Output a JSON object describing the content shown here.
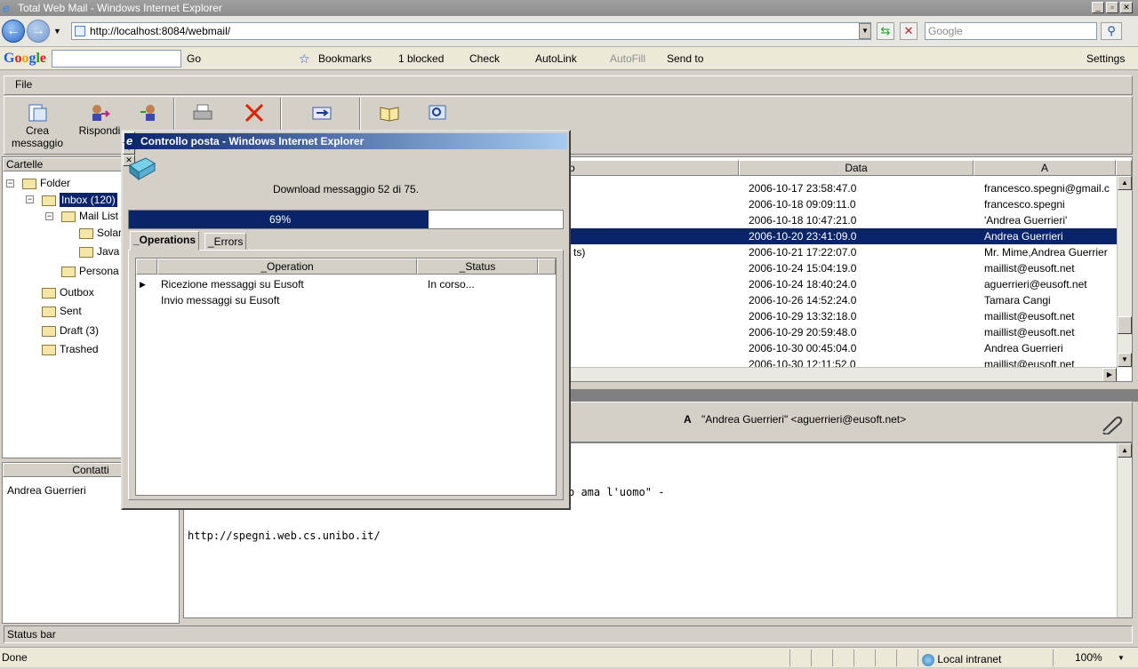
{
  "browser": {
    "title": "Total Web Mail - Windows Internet Explorer",
    "url": "http://localhost:8084/webmail/",
    "search_placeholder": "Google"
  },
  "google_toolbar": {
    "logo": "Google",
    "go": "Go",
    "bookmarks": "Bookmarks",
    "blocked": "1 blocked",
    "check": "Check",
    "autolink": "AutoLink",
    "autofill": "AutoFill",
    "sendto": "Send to",
    "settings": "Settings"
  },
  "app": {
    "menu_file": "File",
    "toolbar": {
      "crea_line1": "Crea",
      "crea_line2": "messaggio",
      "rispondi": "Rispondi"
    },
    "folders_header": "Cartelle",
    "folders": [
      {
        "label": "Folder"
      },
      {
        "label": "Inbox (120)"
      },
      {
        "label": "Mail List"
      },
      {
        "label": "Solar"
      },
      {
        "label": "Java"
      },
      {
        "label": "Persona"
      },
      {
        "label": "Outbox"
      },
      {
        "label": "Sent"
      },
      {
        "label": "Draft (3)"
      },
      {
        "label": "Trashed"
      }
    ],
    "contacts_header": "Contatti",
    "contacts": [
      "Andrea Guerrieri"
    ],
    "list_headers": {
      "subject": "o",
      "date": "Data",
      "to": "A"
    },
    "messages": [
      {
        "subject": "",
        "date": "2006-10-17 23:58:47.0",
        "to": "francesco.spegni@gmail.c"
      },
      {
        "subject": "",
        "date": "2006-10-18 09:09:11.0",
        "to": "francesco.spegni"
      },
      {
        "subject": "",
        "date": "2006-10-18 10:47:21.0",
        "to": "'Andrea Guerrieri'"
      },
      {
        "subject": "",
        "date": "2006-10-20 23:41:09.0",
        "to": "Andrea Guerrieri"
      },
      {
        "subject": "ts)",
        "date": "2006-10-21 17:22:07.0",
        "to": "Mr. Mime,Andrea Guerrier"
      },
      {
        "subject": "",
        "date": "2006-10-24 15:04:19.0",
        "to": "maillist@eusoft.net"
      },
      {
        "subject": "",
        "date": "2006-10-24 18:40:24.0",
        "to": "aguerrieri@eusoft.net"
      },
      {
        "subject": "",
        "date": "2006-10-26 14:52:24.0",
        "to": "Tamara Cangi"
      },
      {
        "subject": "",
        "date": "2006-10-29 13:32:18.0",
        "to": "maillist@eusoft.net"
      },
      {
        "subject": "",
        "date": "2006-10-29 20:59:48.0",
        "to": "maillist@eusoft.net"
      },
      {
        "subject": "",
        "date": "2006-10-30 00:45:04.0",
        "to": "Andrea Guerrieri"
      },
      {
        "subject": "",
        "date": "2006-10-30 12:11:52.0",
        "to": "maillist@eusoft.net"
      }
    ],
    "selected_row": 3,
    "preview": {
      "to_label": "A",
      "to_value": "\"Andrea Guerrieri\" <aguerrieri@eusoft.net>",
      "body_line1": "o ama l'uomo\" -",
      "body_line2": "http://spegni.web.cs.unibo.it/"
    },
    "status_bar": "Status bar"
  },
  "dialog": {
    "title": "Controllo posta - Windows Internet Explorer",
    "message": "Download messaggio 52 di 75.",
    "progress_percent": 69,
    "progress_label": "69%",
    "tabs": [
      "_Operations",
      "_Errors"
    ],
    "columns": [
      "_Operation",
      "_Status"
    ],
    "operations": [
      {
        "operation": "Ricezione messaggi su Eusoft",
        "status": "In corso..."
      },
      {
        "operation": "Invio messaggi su Eusoft",
        "status": ""
      }
    ]
  },
  "ie_status": {
    "left": "Done",
    "zone": "Local intranet",
    "zoom": "100%"
  }
}
